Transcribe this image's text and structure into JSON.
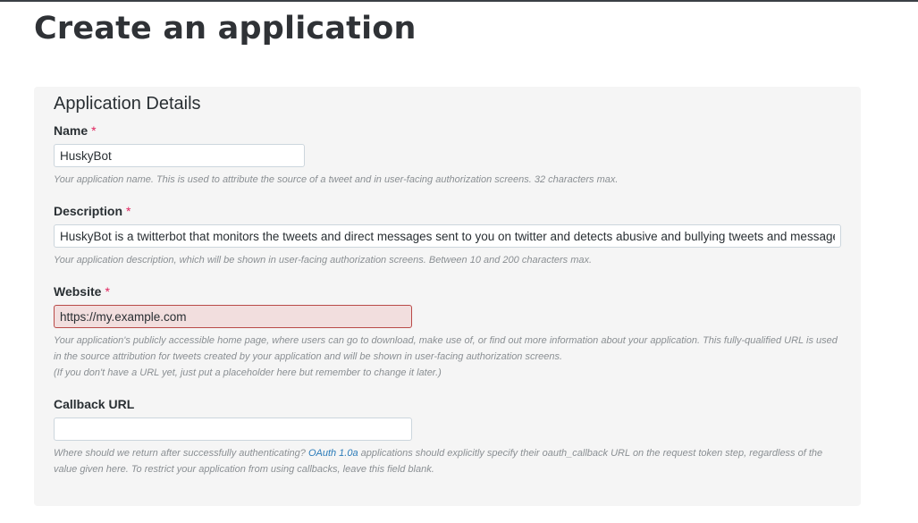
{
  "page": {
    "title": "Create an application"
  },
  "details": {
    "section_title": "Application Details",
    "required_marker": "*",
    "name": {
      "label": "Name",
      "value": "HuskyBot",
      "help": "Your application name. This is used to attribute the source of a tweet and in user-facing authorization screens. 32 characters max."
    },
    "description": {
      "label": "Description",
      "value": "HuskyBot is a twitterbot that monitors the tweets and direct messages sent to you on twitter and detects abusive and bullying tweets and messages",
      "help": "Your application description, which will be shown in user-facing authorization screens. Between 10 and 200 characters max."
    },
    "website": {
      "label": "Website",
      "placeholder": "https://my.example.com",
      "help_line1": "Your application's publicly accessible home page, where users can go to download, make use of, or find out more information about your application. This fully-qualified URL is used in the source attribution for tweets created by your application and will be shown in user-facing authorization screens.",
      "help_line2": "(If you don't have a URL yet, just put a placeholder here but remember to change it later.)"
    },
    "callback": {
      "label": "Callback URL",
      "value": "",
      "help_before": "Where should we return after successfully authenticating? ",
      "help_link": "OAuth 1.0a",
      "help_after": " applications should explicitly specify their oauth_callback URL on the request token step, regardless of the value given here. To restrict your application from using callbacks, leave this field blank."
    }
  },
  "colors": {
    "required": "#e0245e",
    "error_bg": "#f2dede",
    "error_border": "#b94a48",
    "link": "#2b7bb9",
    "panel_bg": "#f5f5f5"
  }
}
